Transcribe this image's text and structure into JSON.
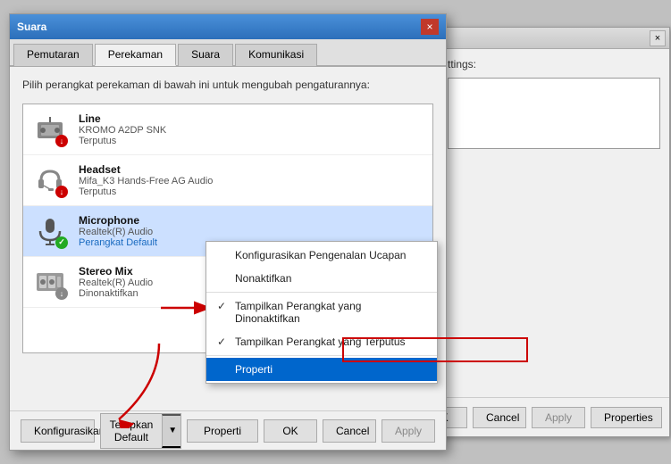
{
  "bgWindow": {
    "closeLabel": "×",
    "settingsLabel": "ttings:",
    "buttons": {
      "ok": "OK",
      "cancel": "Cancel",
      "apply": "Apply",
      "properties": "Properties"
    }
  },
  "dialog": {
    "title": "Suara",
    "closeLabel": "×",
    "tabs": [
      {
        "label": "Pemutaran",
        "active": false
      },
      {
        "label": "Perekaman",
        "active": true
      },
      {
        "label": "Suara",
        "active": false
      },
      {
        "label": "Komunikasi",
        "active": false
      }
    ],
    "description": "Pilih perangkat perekaman di bawah ini untuk mengubah pengaturannya:",
    "devices": [
      {
        "name": "Line",
        "driver": "KROMO A2DP SNK",
        "status": "Terputus",
        "statusType": "disconnected",
        "badgeColor": "red"
      },
      {
        "name": "Headset",
        "driver": "Mifa_K3 Hands-Free AG Audio",
        "status": "Terputus",
        "statusType": "disconnected",
        "badgeColor": "red"
      },
      {
        "name": "Microphone",
        "driver": "Realtek(R) Audio",
        "status": "Perangkat Default",
        "statusType": "default",
        "badgeColor": "green",
        "selected": true
      },
      {
        "name": "Stereo Mix",
        "driver": "Realtek(R) Audio",
        "status": "Dinonaktifkan",
        "statusType": "disabled",
        "badgeColor": "gray"
      }
    ],
    "buttons": {
      "configure": "Konfigurasikan",
      "setDefault": "Tetapkan Default",
      "properties": "Properti",
      "ok": "OK",
      "cancel": "Cancel",
      "apply": "Apply"
    }
  },
  "contextMenu": {
    "items": [
      {
        "label": "Konfigurasikan Pengenalan Ucapan",
        "check": false,
        "highlighted": false
      },
      {
        "label": "Nonaktifkan",
        "check": false,
        "highlighted": false
      },
      {
        "separator": true
      },
      {
        "label": "Tampilkan Perangkat yang Dinonaktifkan",
        "check": true,
        "highlighted": false
      },
      {
        "label": "Tampilkan Perangkat yang Terputus",
        "check": true,
        "highlighted": false
      },
      {
        "separator": true
      },
      {
        "label": "Properti",
        "check": false,
        "highlighted": true
      }
    ]
  }
}
